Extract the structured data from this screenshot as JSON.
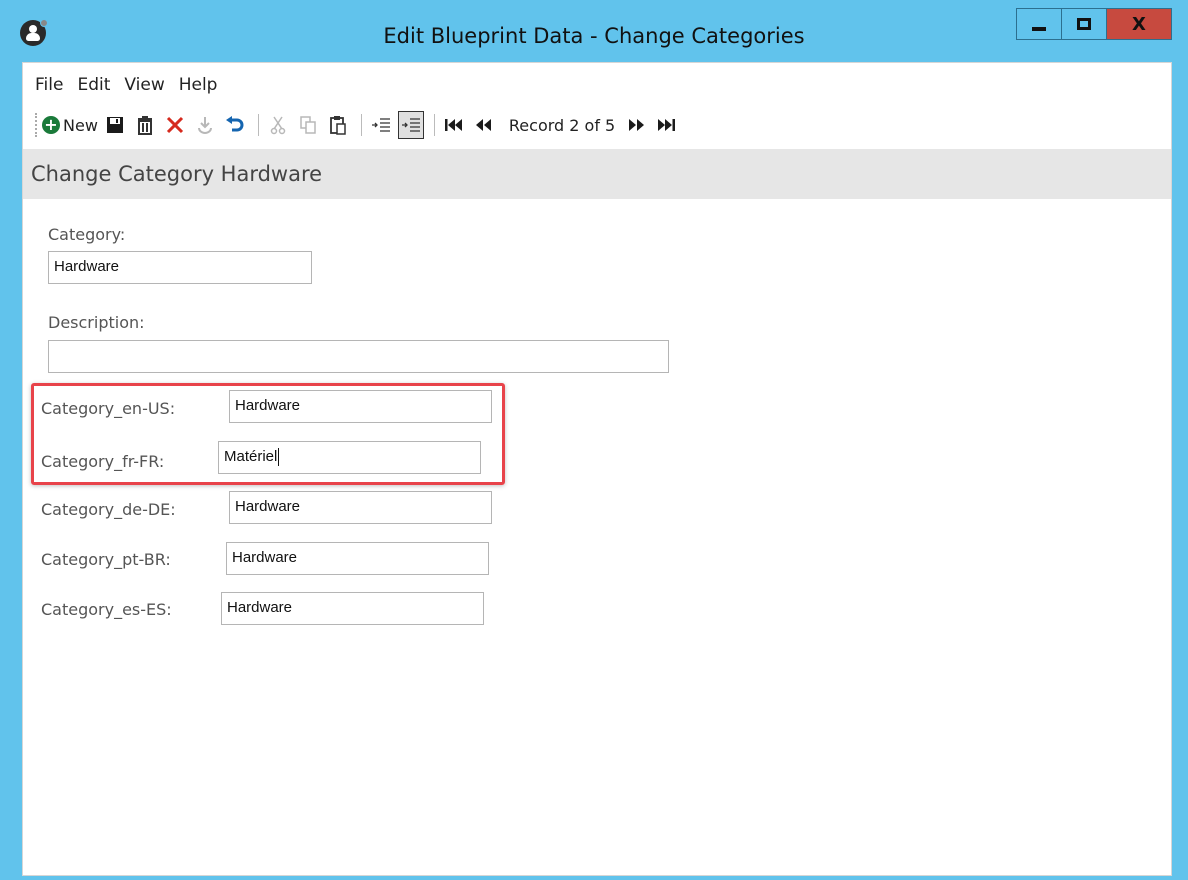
{
  "window": {
    "title": "Edit Blueprint Data - Change Categories",
    "close_label": "X"
  },
  "menu": [
    "File",
    "Edit",
    "View",
    "Help"
  ],
  "toolbar": {
    "new_label": "New",
    "record_text": "Record 2 of 5"
  },
  "header": {
    "title": "Change Category Hardware"
  },
  "form": {
    "category_label": "Category:",
    "category_value": "Hardware",
    "description_label": "Description:",
    "description_value": "",
    "locales": [
      {
        "label": "Category_en-US:",
        "value": "Hardware"
      },
      {
        "label": "Category_fr-FR:",
        "value": "Matériel"
      },
      {
        "label": "Category_de-DE:",
        "value": "Hardware"
      },
      {
        "label": "Category_pt-BR:",
        "value": "Hardware"
      },
      {
        "label": "Category_es-ES:",
        "value": "Hardware"
      }
    ]
  },
  "colors": {
    "titlebar": "#61c3ec",
    "close_button": "#c74a3f",
    "highlight_border": "#e8434a",
    "new_icon": "#1a7a3a"
  }
}
